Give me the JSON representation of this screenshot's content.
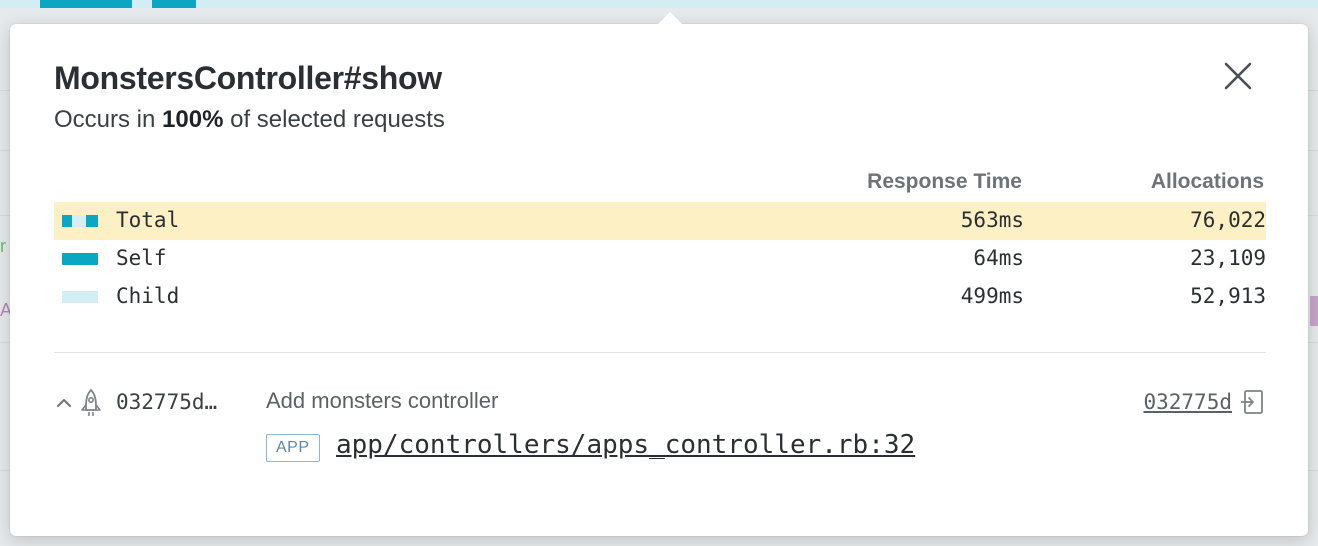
{
  "popover": {
    "title": "MonstersController#show",
    "subtitle_prefix": "Occurs in ",
    "subtitle_percent": "100%",
    "subtitle_suffix": " of selected requests"
  },
  "table": {
    "headers": {
      "response_time": "Response Time",
      "allocations": "Allocations"
    },
    "rows": [
      {
        "label": "Total",
        "response_time": "563ms",
        "allocations": "76,022",
        "highlighted": true
      },
      {
        "label": "Self",
        "response_time": "64ms",
        "allocations": "23,109",
        "highlighted": false
      },
      {
        "label": "Child",
        "response_time": "499ms",
        "allocations": "52,913",
        "highlighted": false
      }
    ]
  },
  "commit": {
    "sha_short": "032775d…",
    "message": "Add monsters controller",
    "sha_link": "032775d",
    "badge": "APP",
    "file": "app/controllers/apps_controller.rb:32"
  },
  "background": {
    "letter_green": "r",
    "letter_purple": "A"
  },
  "colors": {
    "accent": "#0aa6c2",
    "accent_light": "#d4eef3",
    "highlight": "#fdf0c4"
  },
  "icons": {
    "close": "close-icon",
    "chevron": "chevron-up-icon",
    "rocket": "rocket-icon",
    "copy": "copy-icon"
  }
}
